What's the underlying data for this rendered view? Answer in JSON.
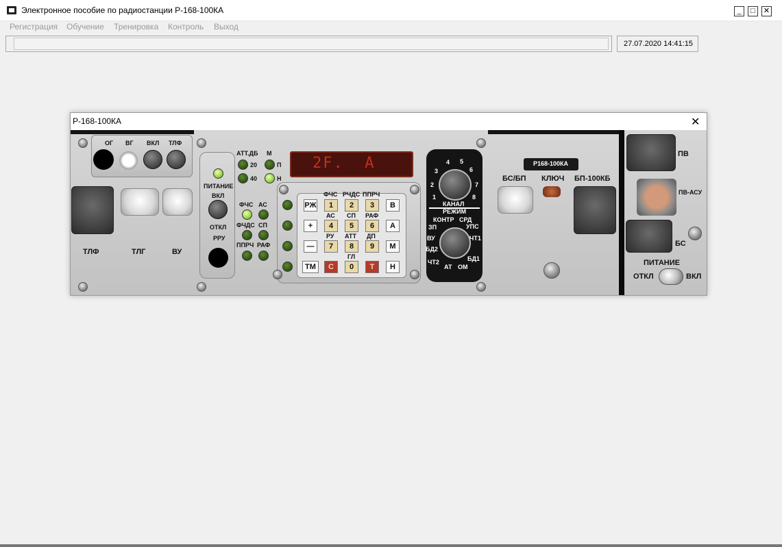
{
  "app": {
    "title": "Электронное пособие по радиостанции Р-168-100КА"
  },
  "window_controls": {
    "minimize": "_",
    "maximize": "□",
    "close": "✕"
  },
  "menu": [
    "Регистрация",
    "Обучение",
    "Тренировка",
    "Контроль",
    "Выход"
  ],
  "status": {
    "datetime": "27.07.2020 14:41:15"
  },
  "inner_window": {
    "title": "Р-168-100КА",
    "close": "✕"
  },
  "panel": {
    "left": {
      "og": "ОГ",
      "vg": "ВГ",
      "vkl": "ВКЛ",
      "tlf": "ТЛФ",
      "tlf_bottom": "ТЛФ",
      "tlg_bottom": "ТЛГ",
      "vu_bottom": "ВУ"
    },
    "power": {
      "label": "ПИТАНИЕ",
      "vkl": "ВКЛ",
      "otkl": "ОТКЛ",
      "rru": "РРУ"
    },
    "att": {
      "att_db": "АТТ.ДБ",
      "m": "М",
      "v20": "20",
      "v40": "40",
      "p": "П",
      "n": "Н"
    },
    "modes": {
      "fchs": "ФЧС",
      "as": "АС",
      "fchds": "ФЧДС",
      "sp": "СП",
      "pprch": "ППРЧ",
      "raf": "РАФ"
    },
    "display": "2F.  A",
    "keypad": {
      "top_labels": [
        "ФЧС",
        "РЧДС",
        "ППРЧ"
      ],
      "row1": [
        "РЖ",
        "1",
        "2",
        "3",
        "В"
      ],
      "row2_labels": [
        "АС",
        "СП",
        "РАФ"
      ],
      "row2": [
        "+",
        "4",
        "5",
        "6",
        "А"
      ],
      "row3_labels": [
        "РУ",
        "АТТ",
        "ДП"
      ],
      "row3": [
        "—",
        "7",
        "8",
        "9",
        "М"
      ],
      "row4_labels": [
        "ГЛ"
      ],
      "row4": [
        "ТМ",
        "С",
        "0",
        "Т",
        "Н"
      ]
    },
    "channel_knob": {
      "ticks": [
        "1",
        "2",
        "3",
        "4",
        "5",
        "6",
        "7",
        "8"
      ],
      "label": "КАНАЛ"
    },
    "mode_knob": {
      "label": "РЕЖИМ",
      "ticks": [
        "КОНТР",
        "СРД",
        "ЗП",
        "УПС",
        "ВУ",
        "ЧТ1",
        "БД2",
        "БД1",
        "ЧТ2",
        "АТ",
        "ОМ"
      ]
    },
    "right": {
      "badge": "Р168-100КА",
      "bs_bp": "БС/БП",
      "kluch": "КЛЮЧ",
      "bp100kb": "БП-100КБ"
    },
    "far_right": {
      "pv": "ПВ",
      "pv_asu": "ПВ-АСУ",
      "bs": "БС",
      "pitanie": "ПИТАНИЕ",
      "otkl": "ОТКЛ",
      "vkl": "ВКЛ"
    }
  }
}
